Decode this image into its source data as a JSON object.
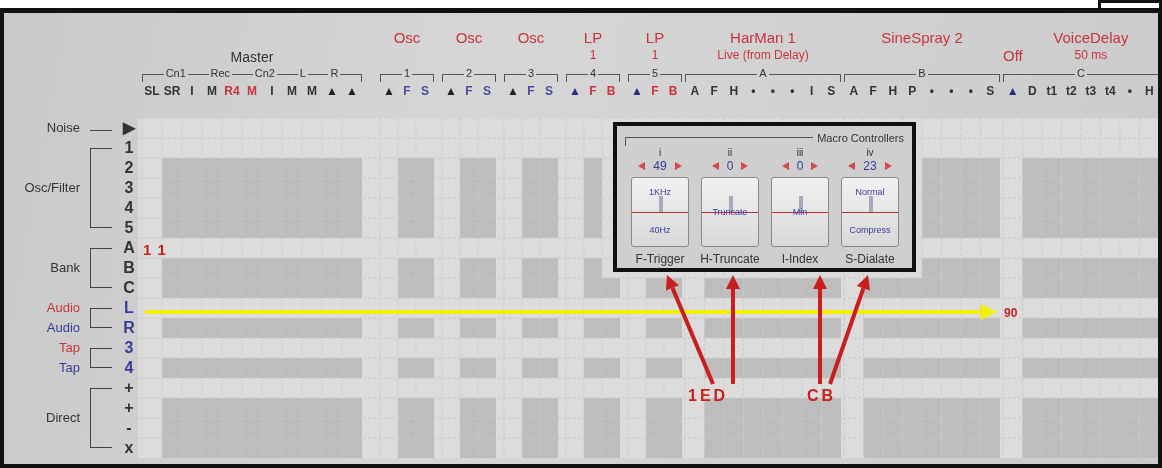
{
  "header": {
    "groups": [
      {
        "kind": "master",
        "title": [
          "Master"
        ],
        "color": "#333333",
        "bracket": [
          "Cn1",
          "Rec",
          "Cn2",
          "L",
          "R"
        ],
        "columns": [
          {
            "label": "SL",
            "color": "#333333"
          },
          {
            "label": "SR",
            "color": "#333333"
          },
          {
            "label": "I",
            "color": "#333333"
          },
          {
            "label": "M",
            "color": "#333333"
          },
          {
            "label": "R4",
            "color": "#c8343a"
          },
          {
            "label": "M",
            "color": "#c8343a"
          },
          {
            "label": "I",
            "color": "#333333"
          },
          {
            "label": "M",
            "color": "#333333"
          },
          {
            "label": "M",
            "color": "#333333"
          },
          {
            "label": "▲",
            "color": "#222222"
          },
          {
            "label": "▲",
            "color": "#222222"
          }
        ]
      },
      {
        "kind": "module",
        "title": [
          "Osc"
        ],
        "color": "#c8343a",
        "bracket": [
          "1"
        ],
        "columns": [
          {
            "label": "▲",
            "color": "#222222"
          },
          {
            "label": "F",
            "color": "#4a4aa0"
          },
          {
            "label": "S",
            "color": "#4a4aa0"
          }
        ]
      },
      {
        "kind": "module",
        "title": [
          "Osc"
        ],
        "color": "#c8343a",
        "bracket": [
          "2"
        ],
        "columns": [
          {
            "label": "▲",
            "color": "#222222"
          },
          {
            "label": "F",
            "color": "#4a4aa0"
          },
          {
            "label": "S",
            "color": "#4a4aa0"
          }
        ]
      },
      {
        "kind": "module",
        "title": [
          "Osc"
        ],
        "color": "#c8343a",
        "bracket": [
          "3"
        ],
        "columns": [
          {
            "label": "▲",
            "color": "#222222"
          },
          {
            "label": "F",
            "color": "#4a4aa0"
          },
          {
            "label": "S",
            "color": "#4a4aa0"
          }
        ]
      },
      {
        "kind": "module",
        "title": [
          "LP",
          "1"
        ],
        "color": "#c8343a",
        "bracket": [
          "4"
        ],
        "columns": [
          {
            "label": "▲",
            "color": "#2a2a8a"
          },
          {
            "label": "F",
            "color": "#c8343a"
          },
          {
            "label": "B",
            "color": "#c8343a"
          }
        ]
      },
      {
        "kind": "module",
        "title": [
          "LP",
          "1"
        ],
        "color": "#c8343a",
        "bracket": [
          "5"
        ],
        "columns": [
          {
            "label": "▲",
            "color": "#2a2a8a"
          },
          {
            "label": "F",
            "color": "#c8343a"
          },
          {
            "label": "B",
            "color": "#c8343a"
          }
        ]
      },
      {
        "kind": "bank",
        "title": [
          "HarMan 1",
          "Live (from Delay)"
        ],
        "color": "#c8343a",
        "bracket": [
          "A"
        ],
        "columns": [
          {
            "label": "A",
            "color": "#333333"
          },
          {
            "label": "F",
            "color": "#333333"
          },
          {
            "label": "H",
            "color": "#333333"
          },
          {
            "label": "•",
            "color": "#333333"
          },
          {
            "label": "•",
            "color": "#333333"
          },
          {
            "label": "•",
            "color": "#333333"
          },
          {
            "label": "I",
            "color": "#333333"
          },
          {
            "label": "S",
            "color": "#333333"
          }
        ]
      },
      {
        "kind": "bank",
        "title": [
          "SineSpray 2"
        ],
        "color": "#c8343a",
        "bracket": [
          "B"
        ],
        "columns": [
          {
            "label": "A",
            "color": "#333333"
          },
          {
            "label": "F",
            "color": "#333333"
          },
          {
            "label": "H",
            "color": "#333333"
          },
          {
            "label": "P",
            "color": "#333333"
          },
          {
            "label": "•",
            "color": "#333333"
          },
          {
            "label": "•",
            "color": "#333333"
          },
          {
            "label": "•",
            "color": "#333333"
          },
          {
            "label": "S",
            "color": "#333333"
          }
        ]
      },
      {
        "kind": "bank",
        "side_label": "Off",
        "title": [
          "VoiceDelay",
          "50 ms"
        ],
        "color": "#c8343a",
        "bracket": [
          "C"
        ],
        "columns": [
          {
            "label": "▲",
            "color": "#2a2a8a"
          },
          {
            "label": "D",
            "color": "#333333"
          },
          {
            "label": "t1",
            "color": "#333333"
          },
          {
            "label": "t2",
            "color": "#333333"
          },
          {
            "label": "t3",
            "color": "#333333"
          },
          {
            "label": "t4",
            "color": "#333333"
          },
          {
            "label": "•",
            "color": "#333333"
          },
          {
            "label": "H",
            "color": "#333333"
          }
        ]
      }
    ]
  },
  "row_groups": [
    {
      "labels": [
        {
          "text": "Noise",
          "color": "#333333"
        }
      ],
      "rows": [
        {
          "text": "▶",
          "color": "#333333"
        }
      ]
    },
    {
      "labels": [
        {
          "text": "Osc/Filter",
          "color": "#333333"
        }
      ],
      "rows": [
        {
          "text": "1",
          "color": "#333333"
        },
        {
          "text": "2",
          "color": "#333333"
        },
        {
          "text": "3",
          "color": "#333333"
        },
        {
          "text": "4",
          "color": "#333333"
        },
        {
          "text": "5",
          "color": "#333333"
        }
      ]
    },
    {
      "labels": [
        {
          "text": "Bank",
          "color": "#333333"
        }
      ],
      "rows": [
        {
          "text": "A",
          "color": "#333333"
        },
        {
          "text": "B",
          "color": "#333333"
        },
        {
          "text": "C",
          "color": "#333333"
        }
      ]
    },
    {
      "labels": [
        {
          "text": "Audio",
          "color": "#c8343a"
        },
        {
          "text": "Audio",
          "color": "#3a3a9a"
        }
      ],
      "rows": [
        {
          "text": "L",
          "color": "#3a3a9a"
        },
        {
          "text": "R",
          "color": "#3a3a9a"
        }
      ]
    },
    {
      "labels": [
        {
          "text": "Tap",
          "color": "#c8343a"
        },
        {
          "text": "Tap",
          "color": "#3a3a9a"
        }
      ],
      "rows": [
        {
          "text": "3",
          "color": "#3a3a9a"
        },
        {
          "text": "4",
          "color": "#3a3a9a"
        }
      ]
    },
    {
      "labels": [
        {
          "text": "Direct",
          "color": "#333333"
        }
      ],
      "rows": [
        {
          "text": "+",
          "color": "#333333"
        },
        {
          "text": "+",
          "color": "#333333"
        },
        {
          "text": "-",
          "color": "#333333"
        },
        {
          "text": "x",
          "color": "#333333"
        }
      ]
    }
  ],
  "macro_panel": {
    "title": "Macro Controllers",
    "controllers": [
      {
        "numeral": "i",
        "value": "49",
        "labels": [
          "1KHz",
          "40Hz"
        ],
        "name": "F-Trigger"
      },
      {
        "numeral": "ii",
        "value": "0",
        "labels": [
          "Truncate"
        ],
        "name": "H-Truncate"
      },
      {
        "numeral": "iii",
        "value": "0",
        "labels": [
          "Min"
        ],
        "name": "I-Index"
      },
      {
        "numeral": "iv",
        "value": "23",
        "labels": [
          "Normal",
          "Compress"
        ],
        "name": "S-Dialate"
      }
    ]
  },
  "annotations": [
    {
      "text": "1 1"
    },
    {
      "text": "90"
    },
    {
      "text": "1ED"
    },
    {
      "text": "CB"
    }
  ]
}
